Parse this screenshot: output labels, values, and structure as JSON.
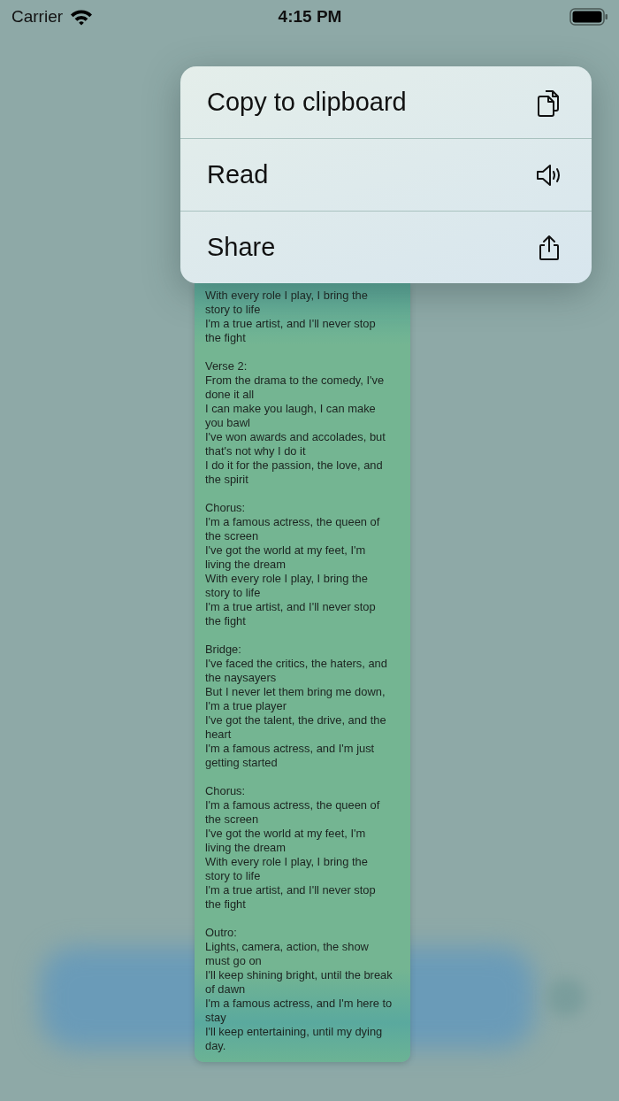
{
  "status_bar": {
    "carrier": "Carrier",
    "time": "4:15 PM"
  },
  "context_menu": {
    "items": [
      {
        "label": "Copy to clipboard",
        "kind": "copy"
      },
      {
        "label": "Read",
        "kind": "speaker"
      },
      {
        "label": "Share",
        "kind": "share"
      }
    ]
  },
  "message": {
    "stanzas": [
      [
        "With every role I play, I bring the story to life",
        "I'm a true artist, and I'll never stop the fight"
      ],
      [
        "Verse 2:",
        "From the drama to the comedy, I've done it all",
        "I can make you laugh, I can make you bawl",
        "I've won awards and accolades, but that's not why I do it",
        "I do it for the passion, the love, and the spirit"
      ],
      [
        "Chorus:",
        "I'm a famous actress, the queen of the screen",
        "I've got the world at my feet, I'm living the dream",
        "With every role I play, I bring the story to life",
        "I'm a true artist, and I'll never stop the fight"
      ],
      [
        "Bridge:",
        "I've faced the critics, the haters, and the naysayers",
        "But I never let them bring me down, I'm a true player",
        "I've got the talent, the drive, and the heart",
        "I'm a famous actress, and I'm just getting started"
      ],
      [
        "Chorus:",
        "I'm a famous actress, the queen of the screen",
        "I've got the world at my feet, I'm living the dream",
        "With every role I play, I bring the story to life",
        "I'm a true artist, and I'll never stop the fight"
      ],
      [
        "Outro:",
        "Lights, camera, action, the show must go on",
        "I'll keep shining bright, until the break of dawn",
        "I'm a famous actress, and I'm here to stay",
        "I'll keep entertaining, until my dying day."
      ]
    ]
  }
}
